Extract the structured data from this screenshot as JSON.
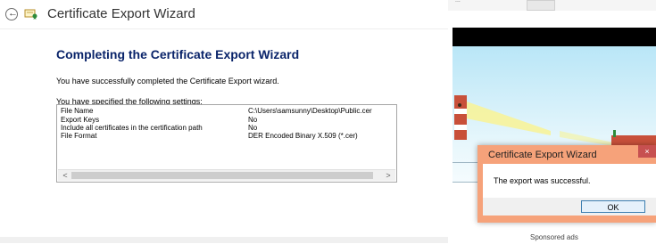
{
  "wizard": {
    "title": "Certificate Export Wizard",
    "heading": "Completing the Certificate Export Wizard",
    "success_text": "You have successfully completed the Certificate Export wizard.",
    "specified_text": "You have specified the following settings:",
    "settings": [
      {
        "key": "File Name",
        "value": "C:\\Users\\samsunny\\Desktop\\Public.cer"
      },
      {
        "key": "Export Keys",
        "value": "No"
      },
      {
        "key": "Include all certificates in the certification path",
        "value": "No"
      },
      {
        "key": "File Format",
        "value": "DER Encoded Binary X.509 (*.cer)"
      }
    ],
    "scroll_left": "<",
    "scroll_right": ">"
  },
  "background": {
    "top_text": "...",
    "sponsored": "Sponsored ads"
  },
  "dialog": {
    "title": "Certificate Export Wizard",
    "close": "×",
    "message": "The export was successful.",
    "ok_label": "OK"
  },
  "colors": {
    "heading": "#0a246a",
    "dialog_frame": "#f6a27a",
    "close_button": "#c75050",
    "ok_border": "#3c7fb1"
  },
  "icons": {
    "back": "back-arrow-icon",
    "cert": "certificate-icon",
    "close": "close-icon"
  }
}
